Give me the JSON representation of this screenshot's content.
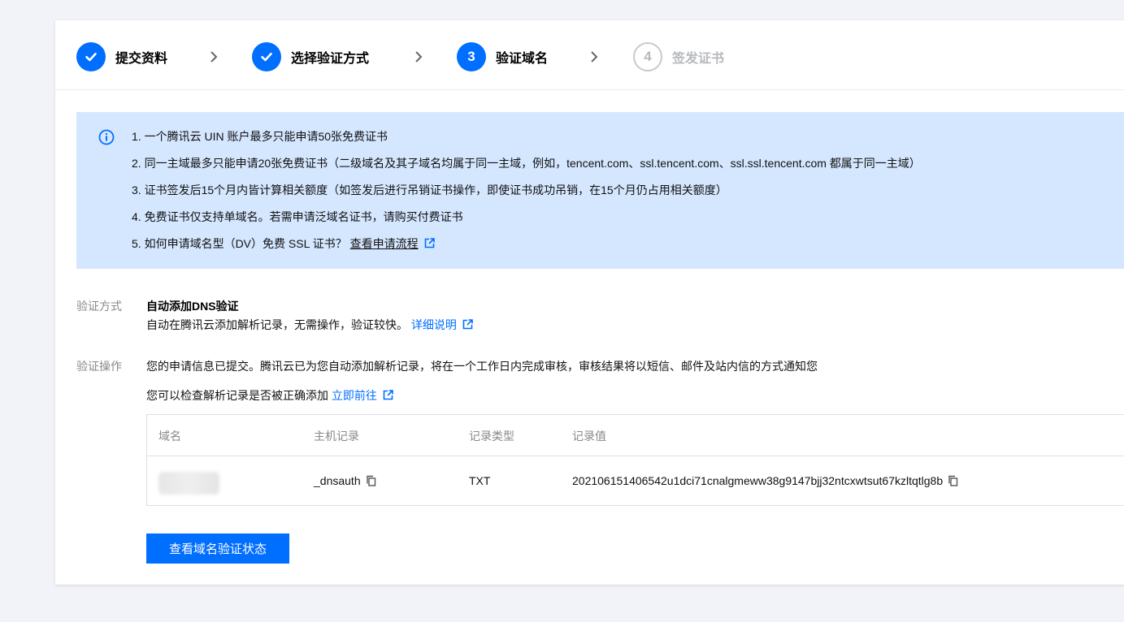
{
  "steps": [
    {
      "label": "提交资料",
      "status": "done"
    },
    {
      "label": "选择验证方式",
      "status": "done"
    },
    {
      "number": "3",
      "label": "验证域名",
      "status": "active"
    },
    {
      "number": "4",
      "label": "签发证书",
      "status": "pending"
    }
  ],
  "notice": {
    "items": [
      "1. 一个腾讯云 UIN 账户最多只能申请50张免费证书",
      "2. 同一主域最多只能申请20张免费证书（二级域名及其子域名均属于同一主域，例如，tencent.com、ssl.tencent.com、ssl.ssl.tencent.com 都属于同一主域）",
      "3. 证书签发后15个月内皆计算相关额度（如签发后进行吊销证书操作，即使证书成功吊销，在15个月仍占用相关额度）",
      "4. 免费证书仅支持单域名。若需申请泛域名证书，请购买付费证书",
      "5. 如何申请域名型（DV）免费 SSL 证书？"
    ],
    "link_text": "查看申请流程"
  },
  "verify_method": {
    "label": "验证方式",
    "title": "自动添加DNS验证",
    "desc": "自动在腾讯云添加解析记录，无需操作，验证较快。",
    "link_text": "详细说明"
  },
  "verify_action": {
    "label": "验证操作",
    "line1": "您的申请信息已提交。腾讯云已为您自动添加解析记录，将在一个工作日内完成审核，审核结果将以短信、邮件及站内信的方式通知您",
    "line2": "您可以检查解析记录是否被正确添加",
    "link_text": "立即前往"
  },
  "table": {
    "headers": [
      "域名",
      "主机记录",
      "记录类型",
      "记录值"
    ],
    "row": {
      "host": "_dnsauth",
      "type": "TXT",
      "value": "202106151406542u1dci71cnalgmeww38g9147bjj32ntcxwtsut67kzltqtlg8b"
    }
  },
  "button_label": "查看域名验证状态",
  "colors": {
    "primary": "#006eff",
    "notice_bg": "#d5e7ff"
  }
}
